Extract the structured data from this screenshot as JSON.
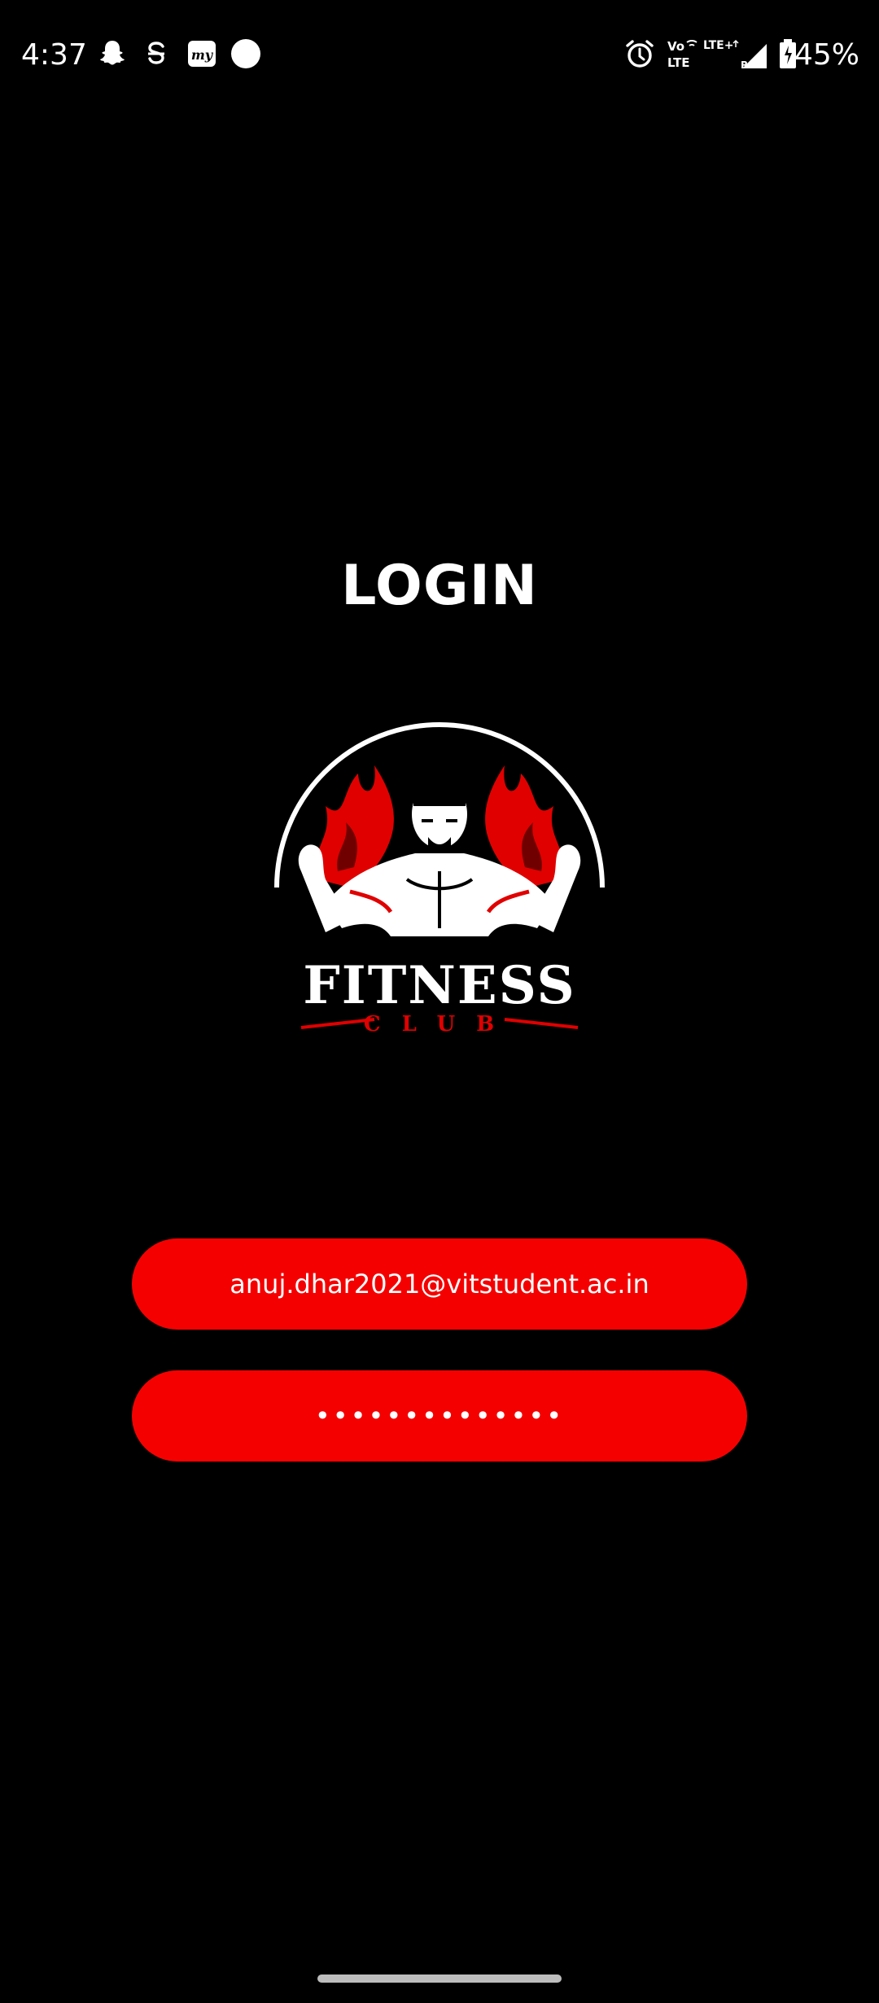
{
  "status_bar": {
    "time": "4:37",
    "battery": "45%",
    "network_top": "LTE+",
    "volte_top": "Vo",
    "volte_bottom": "LTE",
    "roaming": "R",
    "left_icons": [
      "snapchat-icon",
      "s-app-icon",
      "myntra-icon",
      "circle-dot-icon"
    ],
    "right_icons": [
      "alarm-icon",
      "volte-icon",
      "signal-icon",
      "battery-icon"
    ]
  },
  "login": {
    "title": "LOGIN",
    "email_value": "anuj.dhar2021@vitstudent.ac.in",
    "password_value": "••••••••••••••"
  },
  "logo": {
    "brand": "FITNESS",
    "sub": "CLUB"
  },
  "colors": {
    "background": "#000000",
    "accent": "#f50000",
    "text": "#ffffff"
  }
}
